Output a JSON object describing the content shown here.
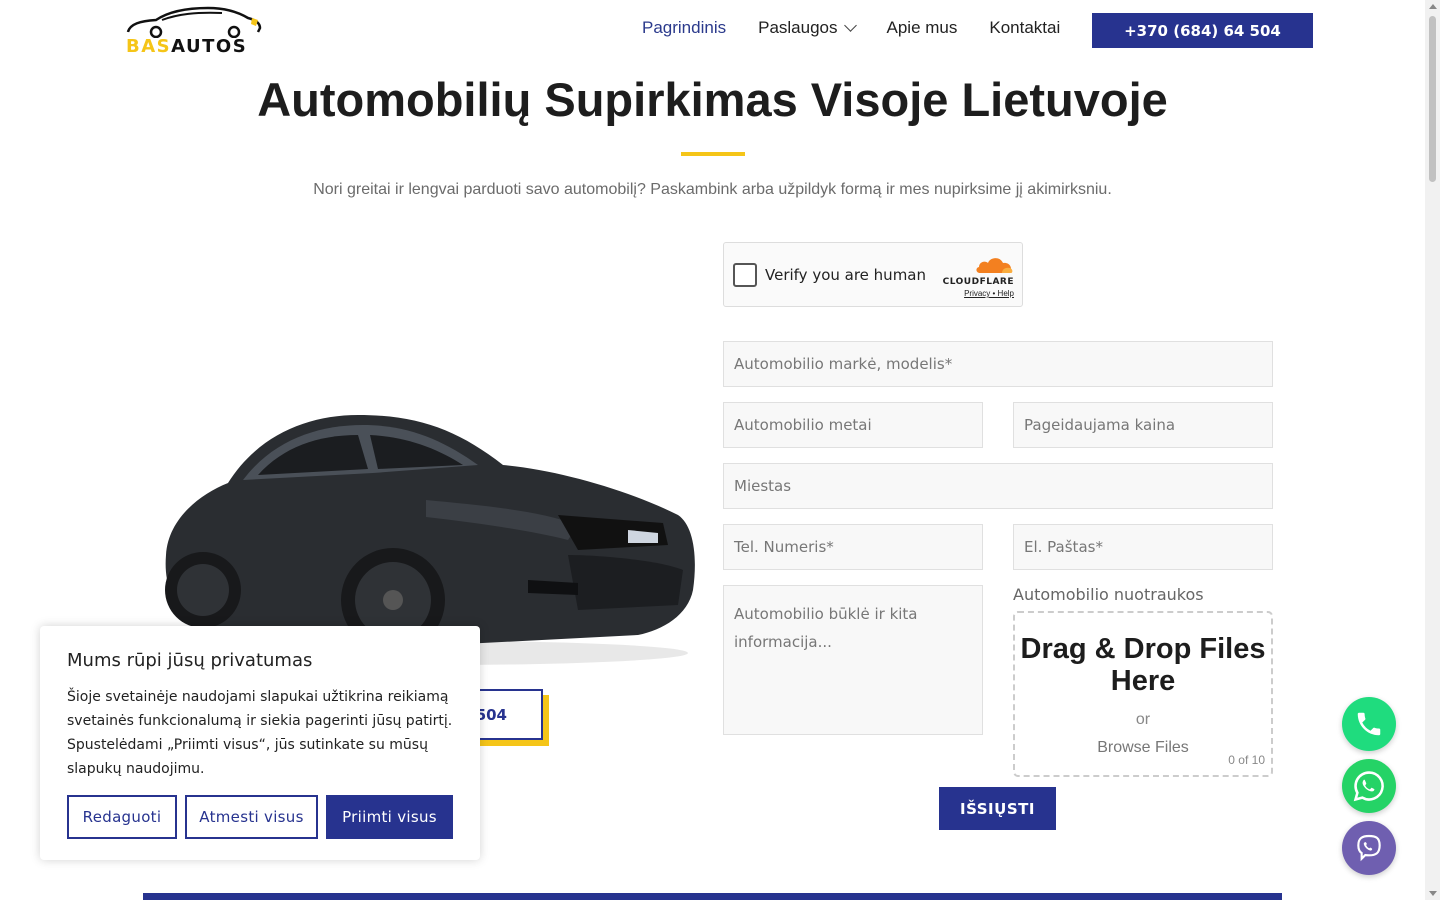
{
  "header": {
    "logo": {
      "part1": "BAS",
      "part2": "AUTOS"
    },
    "nav": [
      {
        "label": "Pagrindinis",
        "active": true
      },
      {
        "label": "Paslaugos",
        "has_dropdown": true
      },
      {
        "label": "Apie mus"
      },
      {
        "label": "Kontaktai"
      }
    ],
    "phone_button": "+370 (684) 64 504"
  },
  "hero": {
    "title": "Automobilių Supirkimas Visoje Lietuvoje",
    "subtitle": "Nori greitai ir lengvai parduoti savo automobilį? Paskambink arba užpildyk formą ir mes nupirksime jį akimirksniu.",
    "call_button_visible": "504"
  },
  "captcha": {
    "label": "Verify you are human",
    "brand": "CLOUDFLARE",
    "links": "Privacy • Help"
  },
  "form": {
    "brand_model": "Automobilio markė, modelis*",
    "year": "Automobilio metai",
    "price": "Pageidaujama kaina",
    "city": "Miestas",
    "phone": "Tel. Numeris*",
    "email": "El. Paštas*",
    "notes": "Automobilio būklė ir kita informacija...",
    "photos_label": "Automobilio nuotraukos",
    "dropzone": {
      "title": "Drag & Drop Files Here",
      "or": "or",
      "browse": "Browse Files",
      "count": "0 of 10"
    },
    "submit": "IŠSIŲSTI"
  },
  "cookie": {
    "title": "Mums rūpi jūsų privatumas",
    "text": "Šioje svetainėje naudojami slapukai užtikrina reikiamą svetainės funkcionalumą ir siekia pagerinti jūsų patirtį. Spustelėdami „Priimti visus“, jūs sutinkate su mūsų slapukų naudojimu.",
    "edit": "Redaguoti",
    "reject": "Atmesti visus",
    "accept": "Priimti visus"
  },
  "floating": [
    {
      "icon": "phone-icon",
      "color": "#1fdc7e"
    },
    {
      "icon": "whatsapp-icon",
      "color": "#25d366"
    },
    {
      "icon": "viber-icon",
      "color": "#6f5fb0"
    }
  ],
  "colors": {
    "brand": "#27338f",
    "accent": "#f5c518"
  }
}
